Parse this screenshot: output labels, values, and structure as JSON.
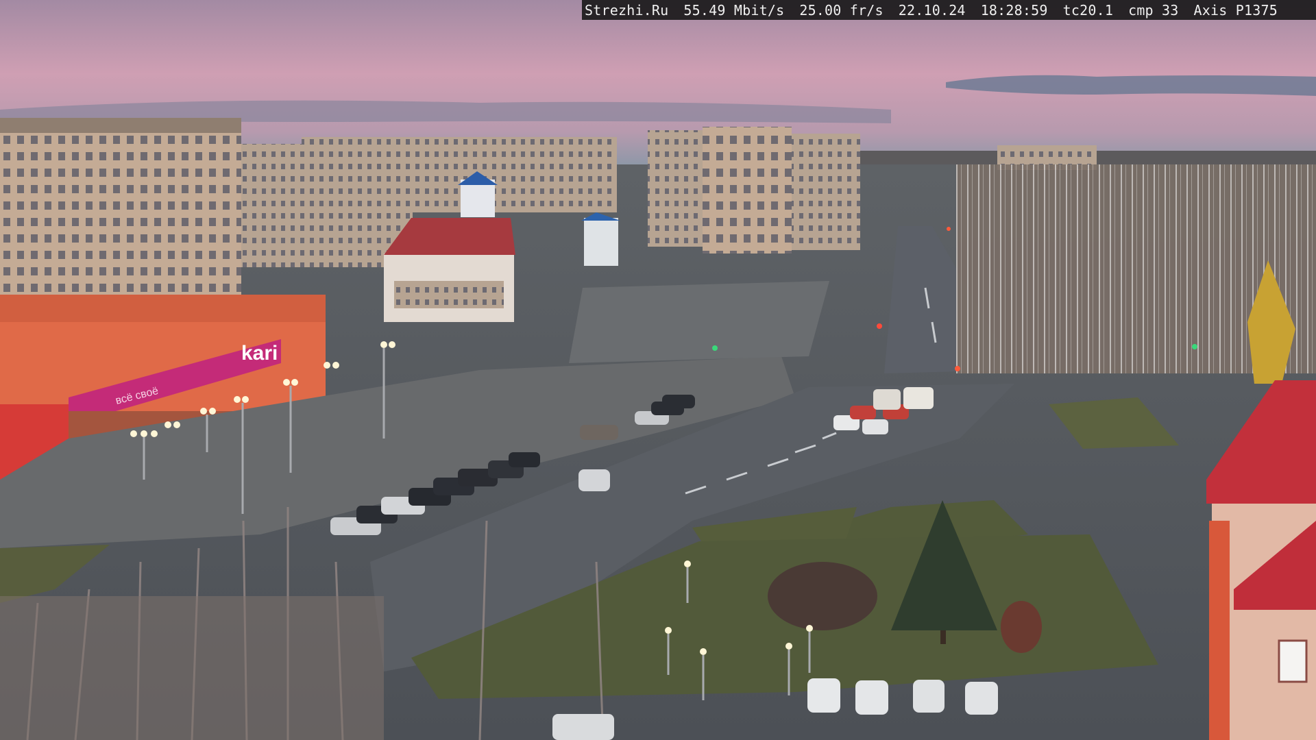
{
  "osd": {
    "site": "Strezhi.Ru",
    "bitrate": "55.49 Mbit/s",
    "framerate": "25.00 fr/s",
    "date": "22.10.24",
    "time": "18:28:59",
    "tc": "tc20.1",
    "cmp": "cmp 33",
    "camera": "Axis P1375"
  },
  "scene": {
    "store_sign": "kari",
    "store_tagline": "всё своё",
    "colors": {
      "sky_top": "#a98fa6",
      "sky_mid": "#d0a3b6",
      "sky_horizon": "#8e96a8",
      "road": "#5c6068",
      "grass": "#525a3a",
      "brick_red": "#a83a3a",
      "store_orange": "#e06a48",
      "store_magenta": "#c42b78"
    }
  }
}
